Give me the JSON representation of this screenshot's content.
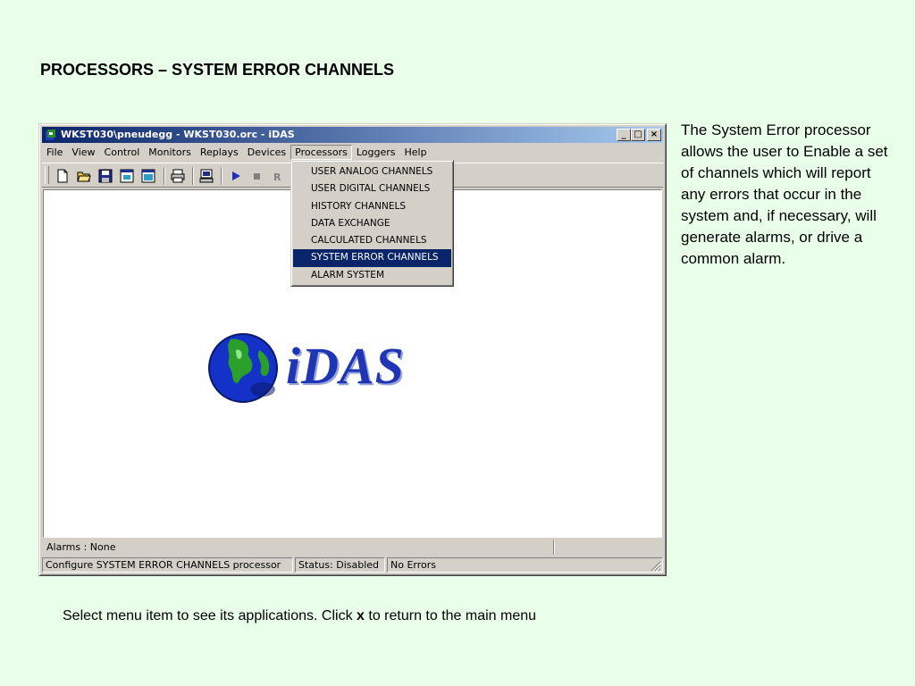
{
  "slide": {
    "title": "PROCESSORS – SYSTEM ERROR CHANNELS",
    "description": "The System Error processor allows the user to Enable a set of channels which will report any errors that occur in the system and, if necessary, will generate alarms, or drive a common alarm.",
    "footer_before": "Select menu item to see its applications. Click ",
    "footer_bold": "x",
    "footer_after": " to return to the main menu"
  },
  "window": {
    "title": "WKST030\\pneudegg - WKST030.orc - iDAS",
    "caption_buttons": [
      "_",
      "□",
      "×"
    ]
  },
  "menubar": {
    "items": [
      "File",
      "View",
      "Control",
      "Monitors",
      "Replays",
      "Devices",
      "Processors",
      "Loggers",
      "Help"
    ],
    "open_item": "Processors"
  },
  "toolbar": {
    "icons": [
      "new-file-icon",
      "open-folder-icon",
      "save-disk-icon",
      "window-icon",
      "window-alt-icon",
      "print-icon",
      "monitor-icon",
      "play-icon",
      "stop-icon",
      "record-icon"
    ],
    "record_label": "R"
  },
  "dropdown": {
    "items": [
      "USER ANALOG CHANNELS",
      "USER DIGITAL CHANNELS",
      "HISTORY CHANNELS",
      "DATA EXCHANGE",
      "CALCULATED CHANNELS",
      "SYSTEM ERROR CHANNELS",
      "ALARM SYSTEM"
    ],
    "selected": "SYSTEM ERROR CHANNELS"
  },
  "logo": {
    "text": "iDAS"
  },
  "alarms": {
    "label": "Alarms :  None"
  },
  "statusbar": {
    "message": "Configure SYSTEM ERROR CHANNELS processor",
    "status": "Status: Disabled",
    "errors": "No Errors"
  },
  "colors": {
    "background": "#eaffea",
    "titlebar_start": "#0a246a",
    "titlebar_end": "#a6caf0",
    "selection": "#0a246a",
    "logo_text": "#1e35b5"
  }
}
